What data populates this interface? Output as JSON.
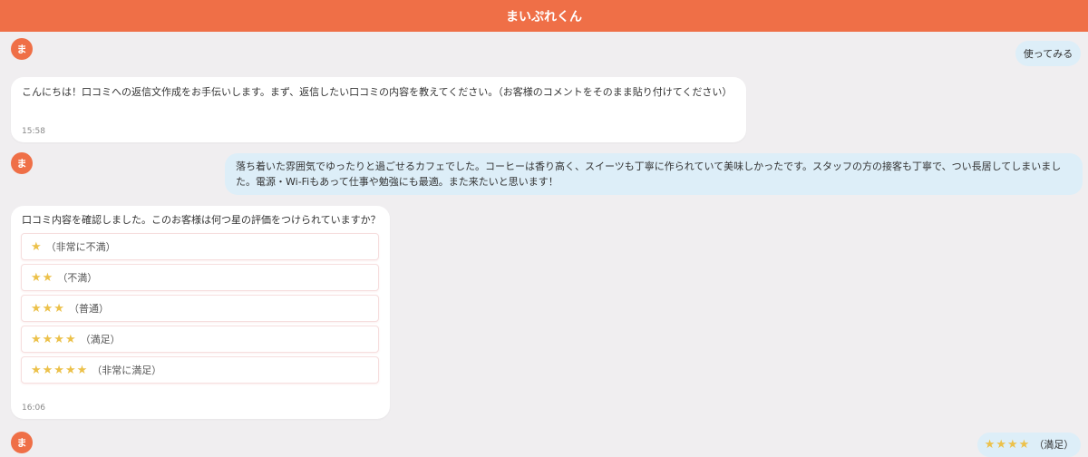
{
  "header": {
    "title": "まいぷれくん"
  },
  "bot": {
    "avatar_label": "ま"
  },
  "messages": {
    "user_start": "使ってみる",
    "bot_greeting": "こんにちは！口コミへの返信文作成をお手伝いします。まず、返信したい口コミの内容を教えてください。（お客様のコメントをそのまま貼り付けてください）",
    "bot_greeting_time": "15:58",
    "user_review": "落ち着いた雰囲気でゆったりと過ごせるカフェでした。コーヒーは香り高く、スイーツも丁寧に作られていて美味しかったです。スタッフの方の接客も丁寧で、つい長居してしまいました。電源・Wi-Fiもあって仕事や勉強にも最適。また来たいと思います！",
    "bot_rating_question": "口コミ内容を確認しました。このお客様は何つ星の評価をつけられていますか？",
    "bot_rating_time": "16:06",
    "user_rating_stars": "★★★★",
    "user_rating_label": "（満足）"
  },
  "rating_options": [
    {
      "stars": "★",
      "label": "（非常に不満）"
    },
    {
      "stars": "★★",
      "label": "（不満）"
    },
    {
      "stars": "★★★",
      "label": "（普通）"
    },
    {
      "stars": "★★★★",
      "label": "（満足）"
    },
    {
      "stars": "★★★★★",
      "label": "（非常に満足）"
    }
  ],
  "colors": {
    "accent": "#ef6f47",
    "user_bubble": "#ddeef8",
    "star": "#ecc14a"
  }
}
